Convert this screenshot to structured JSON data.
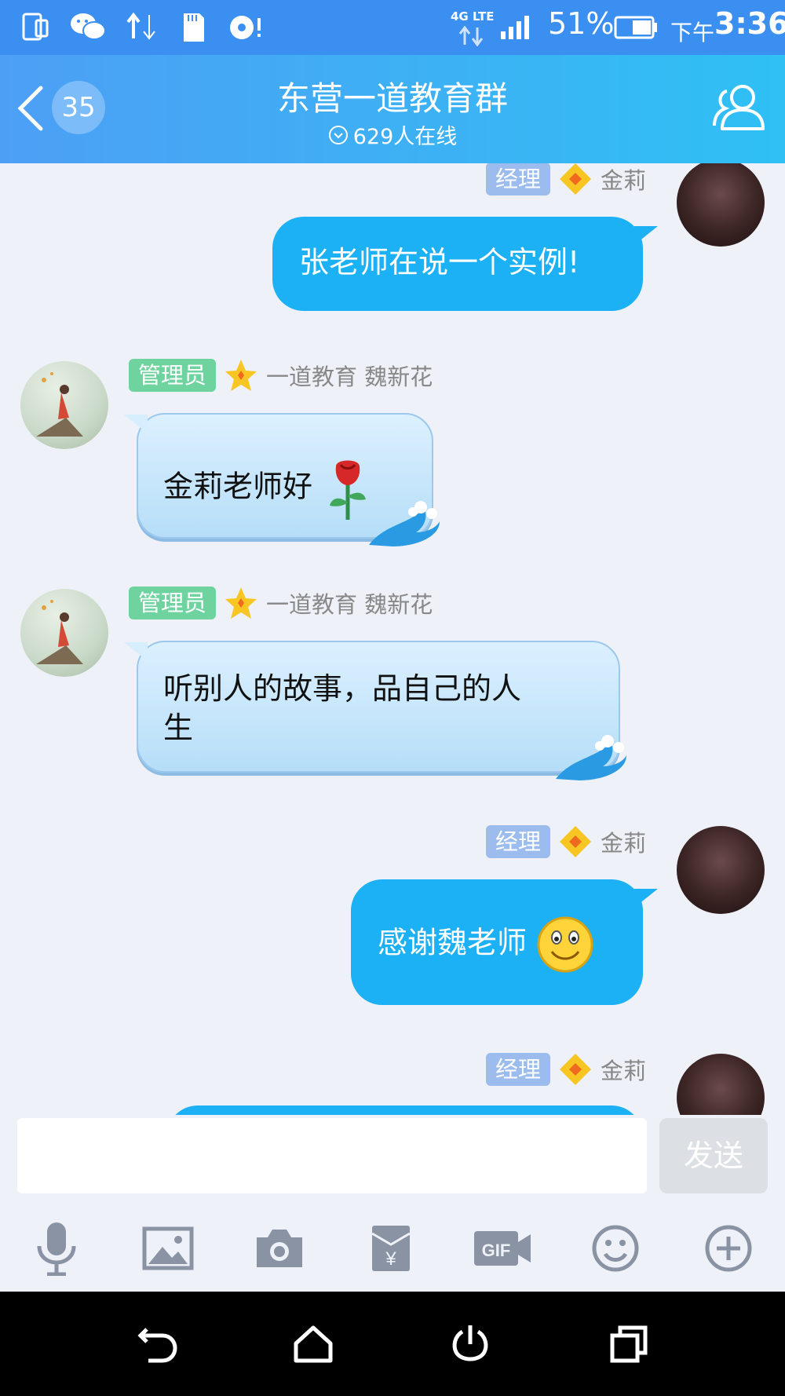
{
  "status_bar": {
    "network": "4G LTE",
    "battery": "51%",
    "time_prefix": "下午",
    "time": "3:36",
    "icons": [
      "phone-icon",
      "wechat-icon",
      "data-transfer-icon",
      "sd-card-icon",
      "sync-alert-icon",
      "signal-icon",
      "battery-icon"
    ]
  },
  "header": {
    "unread_count": "35",
    "title": "东营一道教育群",
    "online_text": "629人在线"
  },
  "messages": [
    {
      "sender": "金莉",
      "role": "经理",
      "side": "right",
      "text": "张老师在说一个实例!"
    },
    {
      "sender": "一道教育 魏新花",
      "role": "管理员",
      "side": "left",
      "text": "金莉老师好",
      "emoji": "rose-emoji"
    },
    {
      "sender": "一道教育 魏新花",
      "role": "管理员",
      "side": "left",
      "text_line1": "听别人的故事，品自己的人",
      "text_line2": "生"
    },
    {
      "sender": "金莉",
      "role": "经理",
      "side": "right",
      "text": "感谢魏老师",
      "emoji": "smile-emoji"
    },
    {
      "sender": "金莉",
      "role": "经理",
      "side": "right",
      "text": ""
    }
  ],
  "input": {
    "value": "",
    "send_label": "发送"
  },
  "toolbar": [
    "microphone-icon",
    "image-icon",
    "camera-icon",
    "red-packet-icon",
    "gif-icon",
    "emoji-icon",
    "plus-icon"
  ],
  "colors": {
    "header_start": "#4d9ff5",
    "header_end": "#2fc0f4",
    "self_bubble": "#1cb0f4",
    "manager_tag": "#9bbcec",
    "admin_tag": "#6fd3a0"
  }
}
